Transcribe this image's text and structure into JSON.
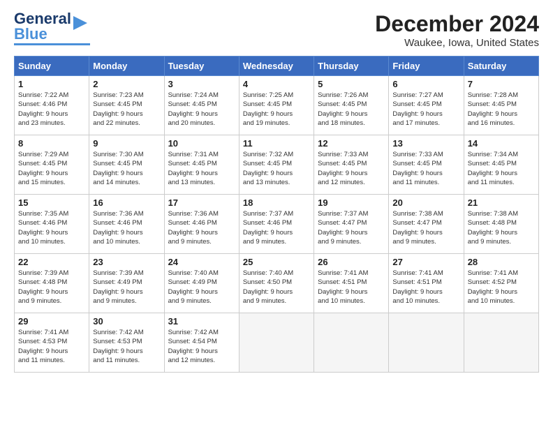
{
  "logo": {
    "text1": "General",
    "text2": "Blue"
  },
  "title": "December 2024",
  "location": "Waukee, Iowa, United States",
  "headers": [
    "Sunday",
    "Monday",
    "Tuesday",
    "Wednesday",
    "Thursday",
    "Friday",
    "Saturday"
  ],
  "weeks": [
    [
      {
        "day": "1",
        "info": "Sunrise: 7:22 AM\nSunset: 4:46 PM\nDaylight: 9 hours\nand 23 minutes."
      },
      {
        "day": "2",
        "info": "Sunrise: 7:23 AM\nSunset: 4:45 PM\nDaylight: 9 hours\nand 22 minutes."
      },
      {
        "day": "3",
        "info": "Sunrise: 7:24 AM\nSunset: 4:45 PM\nDaylight: 9 hours\nand 20 minutes."
      },
      {
        "day": "4",
        "info": "Sunrise: 7:25 AM\nSunset: 4:45 PM\nDaylight: 9 hours\nand 19 minutes."
      },
      {
        "day": "5",
        "info": "Sunrise: 7:26 AM\nSunset: 4:45 PM\nDaylight: 9 hours\nand 18 minutes."
      },
      {
        "day": "6",
        "info": "Sunrise: 7:27 AM\nSunset: 4:45 PM\nDaylight: 9 hours\nand 17 minutes."
      },
      {
        "day": "7",
        "info": "Sunrise: 7:28 AM\nSunset: 4:45 PM\nDaylight: 9 hours\nand 16 minutes."
      }
    ],
    [
      {
        "day": "8",
        "info": "Sunrise: 7:29 AM\nSunset: 4:45 PM\nDaylight: 9 hours\nand 15 minutes."
      },
      {
        "day": "9",
        "info": "Sunrise: 7:30 AM\nSunset: 4:45 PM\nDaylight: 9 hours\nand 14 minutes."
      },
      {
        "day": "10",
        "info": "Sunrise: 7:31 AM\nSunset: 4:45 PM\nDaylight: 9 hours\nand 13 minutes."
      },
      {
        "day": "11",
        "info": "Sunrise: 7:32 AM\nSunset: 4:45 PM\nDaylight: 9 hours\nand 13 minutes."
      },
      {
        "day": "12",
        "info": "Sunrise: 7:33 AM\nSunset: 4:45 PM\nDaylight: 9 hours\nand 12 minutes."
      },
      {
        "day": "13",
        "info": "Sunrise: 7:33 AM\nSunset: 4:45 PM\nDaylight: 9 hours\nand 11 minutes."
      },
      {
        "day": "14",
        "info": "Sunrise: 7:34 AM\nSunset: 4:45 PM\nDaylight: 9 hours\nand 11 minutes."
      }
    ],
    [
      {
        "day": "15",
        "info": "Sunrise: 7:35 AM\nSunset: 4:46 PM\nDaylight: 9 hours\nand 10 minutes."
      },
      {
        "day": "16",
        "info": "Sunrise: 7:36 AM\nSunset: 4:46 PM\nDaylight: 9 hours\nand 10 minutes."
      },
      {
        "day": "17",
        "info": "Sunrise: 7:36 AM\nSunset: 4:46 PM\nDaylight: 9 hours\nand 9 minutes."
      },
      {
        "day": "18",
        "info": "Sunrise: 7:37 AM\nSunset: 4:46 PM\nDaylight: 9 hours\nand 9 minutes."
      },
      {
        "day": "19",
        "info": "Sunrise: 7:37 AM\nSunset: 4:47 PM\nDaylight: 9 hours\nand 9 minutes."
      },
      {
        "day": "20",
        "info": "Sunrise: 7:38 AM\nSunset: 4:47 PM\nDaylight: 9 hours\nand 9 minutes."
      },
      {
        "day": "21",
        "info": "Sunrise: 7:38 AM\nSunset: 4:48 PM\nDaylight: 9 hours\nand 9 minutes."
      }
    ],
    [
      {
        "day": "22",
        "info": "Sunrise: 7:39 AM\nSunset: 4:48 PM\nDaylight: 9 hours\nand 9 minutes."
      },
      {
        "day": "23",
        "info": "Sunrise: 7:39 AM\nSunset: 4:49 PM\nDaylight: 9 hours\nand 9 minutes."
      },
      {
        "day": "24",
        "info": "Sunrise: 7:40 AM\nSunset: 4:49 PM\nDaylight: 9 hours\nand 9 minutes."
      },
      {
        "day": "25",
        "info": "Sunrise: 7:40 AM\nSunset: 4:50 PM\nDaylight: 9 hours\nand 9 minutes."
      },
      {
        "day": "26",
        "info": "Sunrise: 7:41 AM\nSunset: 4:51 PM\nDaylight: 9 hours\nand 10 minutes."
      },
      {
        "day": "27",
        "info": "Sunrise: 7:41 AM\nSunset: 4:51 PM\nDaylight: 9 hours\nand 10 minutes."
      },
      {
        "day": "28",
        "info": "Sunrise: 7:41 AM\nSunset: 4:52 PM\nDaylight: 9 hours\nand 10 minutes."
      }
    ],
    [
      {
        "day": "29",
        "info": "Sunrise: 7:41 AM\nSunset: 4:53 PM\nDaylight: 9 hours\nand 11 minutes."
      },
      {
        "day": "30",
        "info": "Sunrise: 7:42 AM\nSunset: 4:53 PM\nDaylight: 9 hours\nand 11 minutes."
      },
      {
        "day": "31",
        "info": "Sunrise: 7:42 AM\nSunset: 4:54 PM\nDaylight: 9 hours\nand 12 minutes."
      },
      {
        "day": "",
        "info": ""
      },
      {
        "day": "",
        "info": ""
      },
      {
        "day": "",
        "info": ""
      },
      {
        "day": "",
        "info": ""
      }
    ]
  ]
}
